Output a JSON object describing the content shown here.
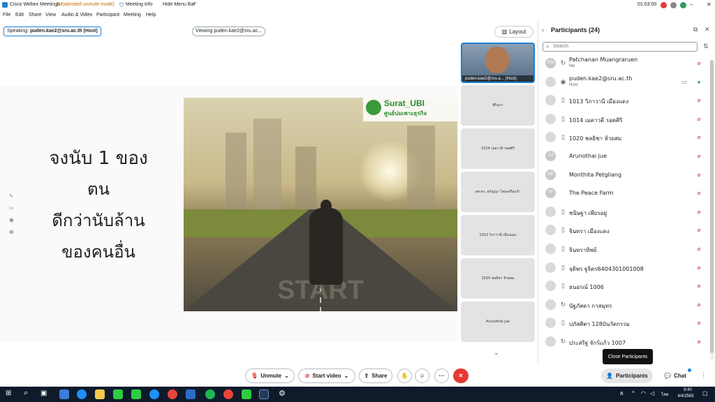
{
  "titlebar": {
    "app": "Cisco Webex Meetings",
    "mode": "(Moderated unmute mode)",
    "meeting_info": "Meeting Info",
    "hide_menu": "Hide Menu Bar",
    "timer": "01:03:00"
  },
  "menu": [
    "File",
    "Edit",
    "Share",
    "View",
    "Audio & Video",
    "Participant",
    "Meeting",
    "Help"
  ],
  "stage": {
    "speaking_label": "Speaking:",
    "speaking_name": "puden.kae2@sru.ac.th (Host)",
    "viewing": "Viewing puden.kae2@sru.ac...",
    "slide_lines": [
      "จงนับ 1 ของ",
      "ตน",
      "ดีกว่านับล้าน",
      "ของคนอื่น"
    ],
    "logo_text": "Surat_UBI",
    "logo_sub": "ศูนย์บ่มเพาะธุรกิจ",
    "road_text": "START"
  },
  "strip": {
    "layout_label": "Layout",
    "host_label": "puden.kae2@sru.a... (Host)",
    "tiles": [
      "สิรินภา",
      "1014 เมตาวดี รอดศิริ",
      "ผศ.ดร. สุกัญญา ไหมเครือแก้ว",
      "1013 วิภาวานี เมืองแดง",
      "1020 ชลธิชา ห้วยสม",
      "Arunothai jue"
    ]
  },
  "participants": {
    "title": "Participants (24)",
    "search_placeholder": "Search",
    "list": [
      {
        "name": "Patchanan Muangraruen",
        "sub": "Me",
        "avatar": "PM",
        "device": "sync"
      },
      {
        "name": "puden.kae2@sru.ac.th",
        "sub": "Host",
        "avatar": "",
        "device": "photo"
      },
      {
        "name": "1013 วิภาวานี เมืองแดง",
        "sub": "",
        "avatar": "",
        "device": "phone"
      },
      {
        "name": "1014 เมตาวดี รอดศิริ",
        "sub": "",
        "avatar": "",
        "device": "phone"
      },
      {
        "name": "1020 ชลธิชา ห้วยสม",
        "sub": "",
        "avatar": "",
        "device": "phone"
      },
      {
        "name": "Arunothai jue",
        "sub": "",
        "avatar": "AJ",
        "device": ""
      },
      {
        "name": "Monthita Petgliang",
        "sub": "",
        "avatar": "MP",
        "device": ""
      },
      {
        "name": "The Peace Farm",
        "sub": "",
        "avatar": "TF",
        "device": ""
      },
      {
        "name": "ชนิษฐา เพียรอยู่",
        "sub": "",
        "avatar": "",
        "device": "phone"
      },
      {
        "name": "จินทรา เมืองแดง",
        "sub": "",
        "avatar": "",
        "device": "phone"
      },
      {
        "name": "จินทราทิพย์",
        "sub": "",
        "avatar": "",
        "device": "phone"
      },
      {
        "name": "จุติพร ฐูจิตร6404301001008",
        "sub": "",
        "avatar": "",
        "device": "phone"
      },
      {
        "name": "ธนอรณ์ 1006",
        "sub": "",
        "avatar": "",
        "device": "phone"
      },
      {
        "name": "นัฐภัสดา กาสมุทร",
        "sub": "",
        "avatar": "",
        "device": "sync"
      },
      {
        "name": "ปภัสศิตา 1280นวัตกรรม",
        "sub": "",
        "avatar": "",
        "device": "phone"
      },
      {
        "name": "ประสริฐ จักร์แก้ว 1007",
        "sub": "",
        "avatar": "",
        "device": "sync"
      }
    ],
    "tooltip": "Close Participants"
  },
  "controls": {
    "unmute": "Unmute",
    "start_video": "Start video",
    "share": "Share",
    "participants": "Participants",
    "chat": "Chat"
  },
  "taskbar": {
    "time": "9:40",
    "date": "4/4/2565",
    "lang": "ไทย"
  },
  "colors": {
    "accent": "#0a6ed1",
    "end": "#e53935",
    "mic_off": "#d33"
  }
}
